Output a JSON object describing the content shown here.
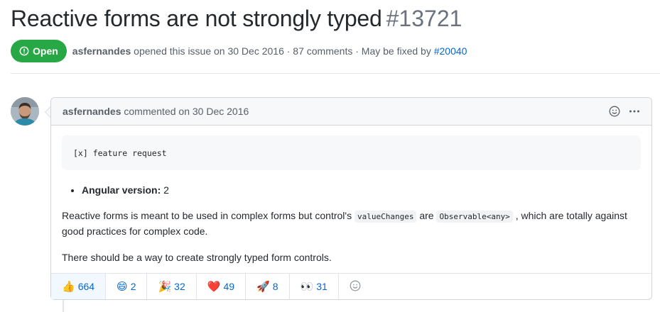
{
  "issue": {
    "title": "Reactive forms are not strongly typed",
    "number": "#13721",
    "state": "Open",
    "author": "asfernandes",
    "opened_text": "opened this issue on 30 Dec 2016 · 87 comments · May be fixed by",
    "fix_pr": "#20040"
  },
  "comment": {
    "author": "asfernandes",
    "meta": "commented on 30 Dec 2016",
    "code_block": "[x] feature request",
    "bullet_label": "Angular version:",
    "bullet_value": " 2",
    "para1_a": "Reactive forms is meant to be used in complex forms but control's ",
    "para1_code1": "valueChanges",
    "para1_b": " are ",
    "para1_code2": "Observable<any>",
    "para1_c": " , which are totally against good practices for complex code.",
    "para2": "There should be a way to create strongly typed form controls."
  },
  "reactions": [
    {
      "icon": "thumbs-up",
      "emoji": "👍",
      "count": "664",
      "active": true
    },
    {
      "icon": "smile",
      "emoji": "😄",
      "count": "2"
    },
    {
      "icon": "tada",
      "emoji": "🎉",
      "count": "32"
    },
    {
      "icon": "heart",
      "emoji": "❤️",
      "count": "49"
    },
    {
      "icon": "rocket",
      "emoji": "🚀",
      "count": "8"
    },
    {
      "icon": "eyes",
      "emoji": "👀",
      "count": "31"
    }
  ],
  "colors": {
    "open_badge": "#28a745",
    "link": "#0366d6",
    "muted": "#586069"
  }
}
